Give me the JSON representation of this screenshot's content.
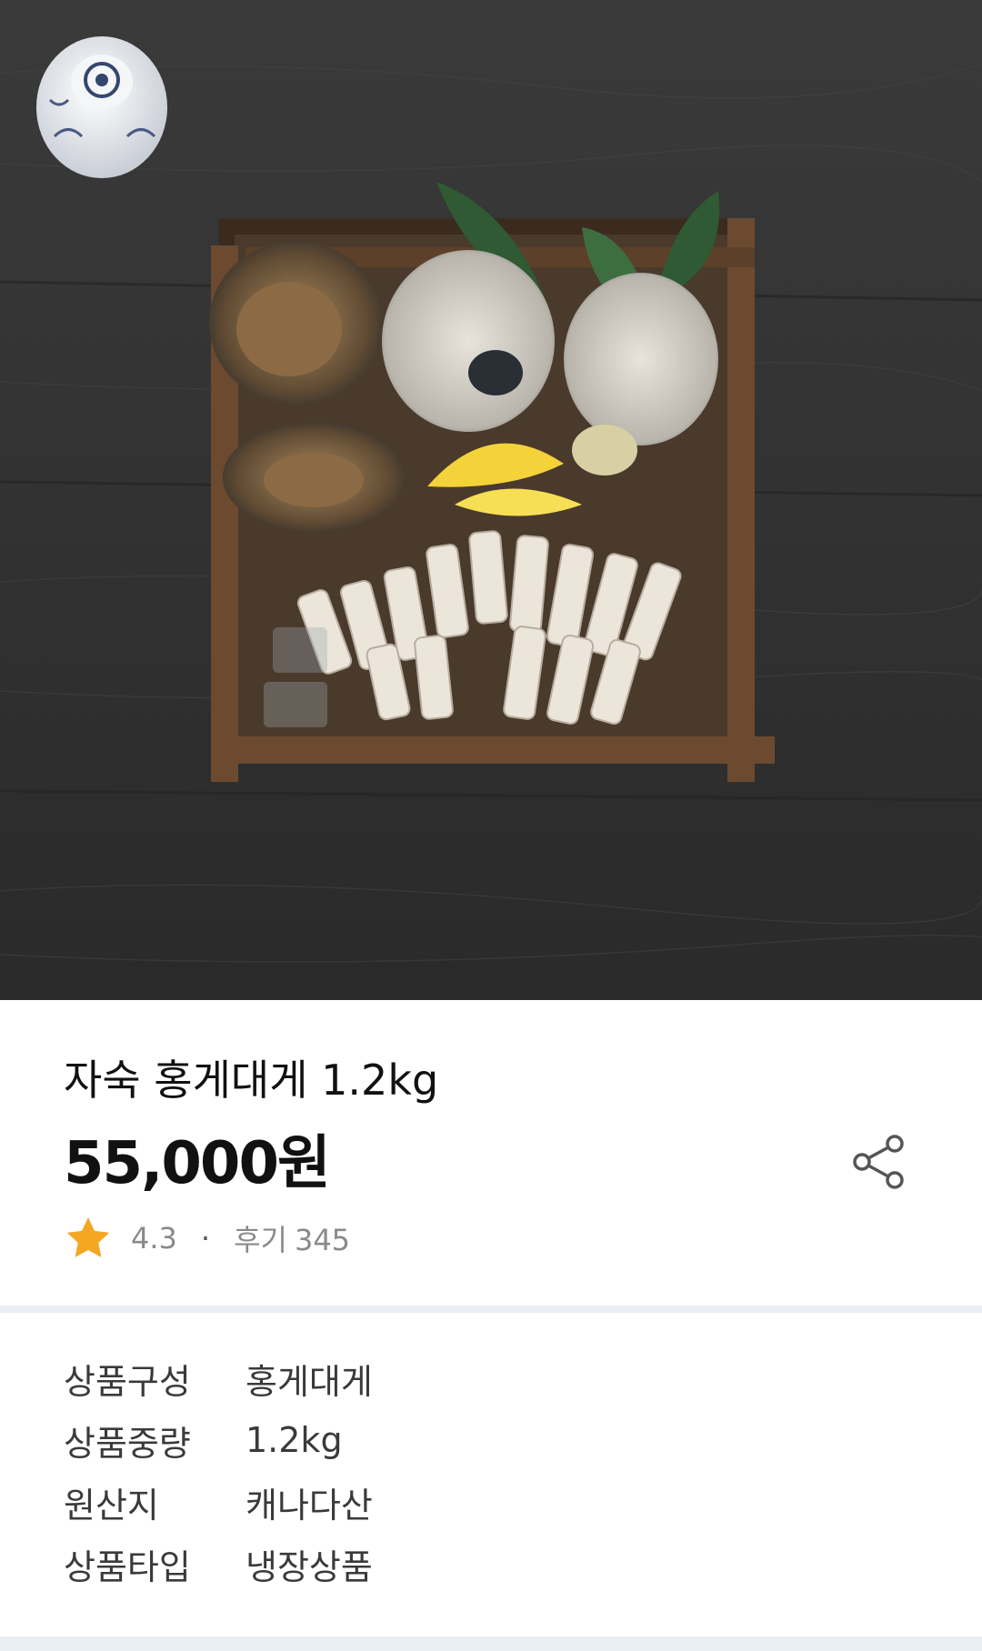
{
  "product": {
    "title": "자숙 홍게대게 1.2kg",
    "price": "55,000원",
    "rating": "4.3",
    "separator": "·",
    "review_label": "후기",
    "review_count": "345"
  },
  "specs": [
    {
      "label": "상품구성",
      "value": "홍게대게"
    },
    {
      "label": "상품중량",
      "value": "1.2kg"
    },
    {
      "label": "원산지",
      "value": "캐나다산"
    },
    {
      "label": "상품타입",
      "value": "냉장상품"
    }
  ],
  "icons": {
    "star": "star-icon",
    "share": "share-icon"
  },
  "colors": {
    "star": "#f5a623",
    "divider": "#e9eef5",
    "muted_text": "#8a8a8a"
  }
}
